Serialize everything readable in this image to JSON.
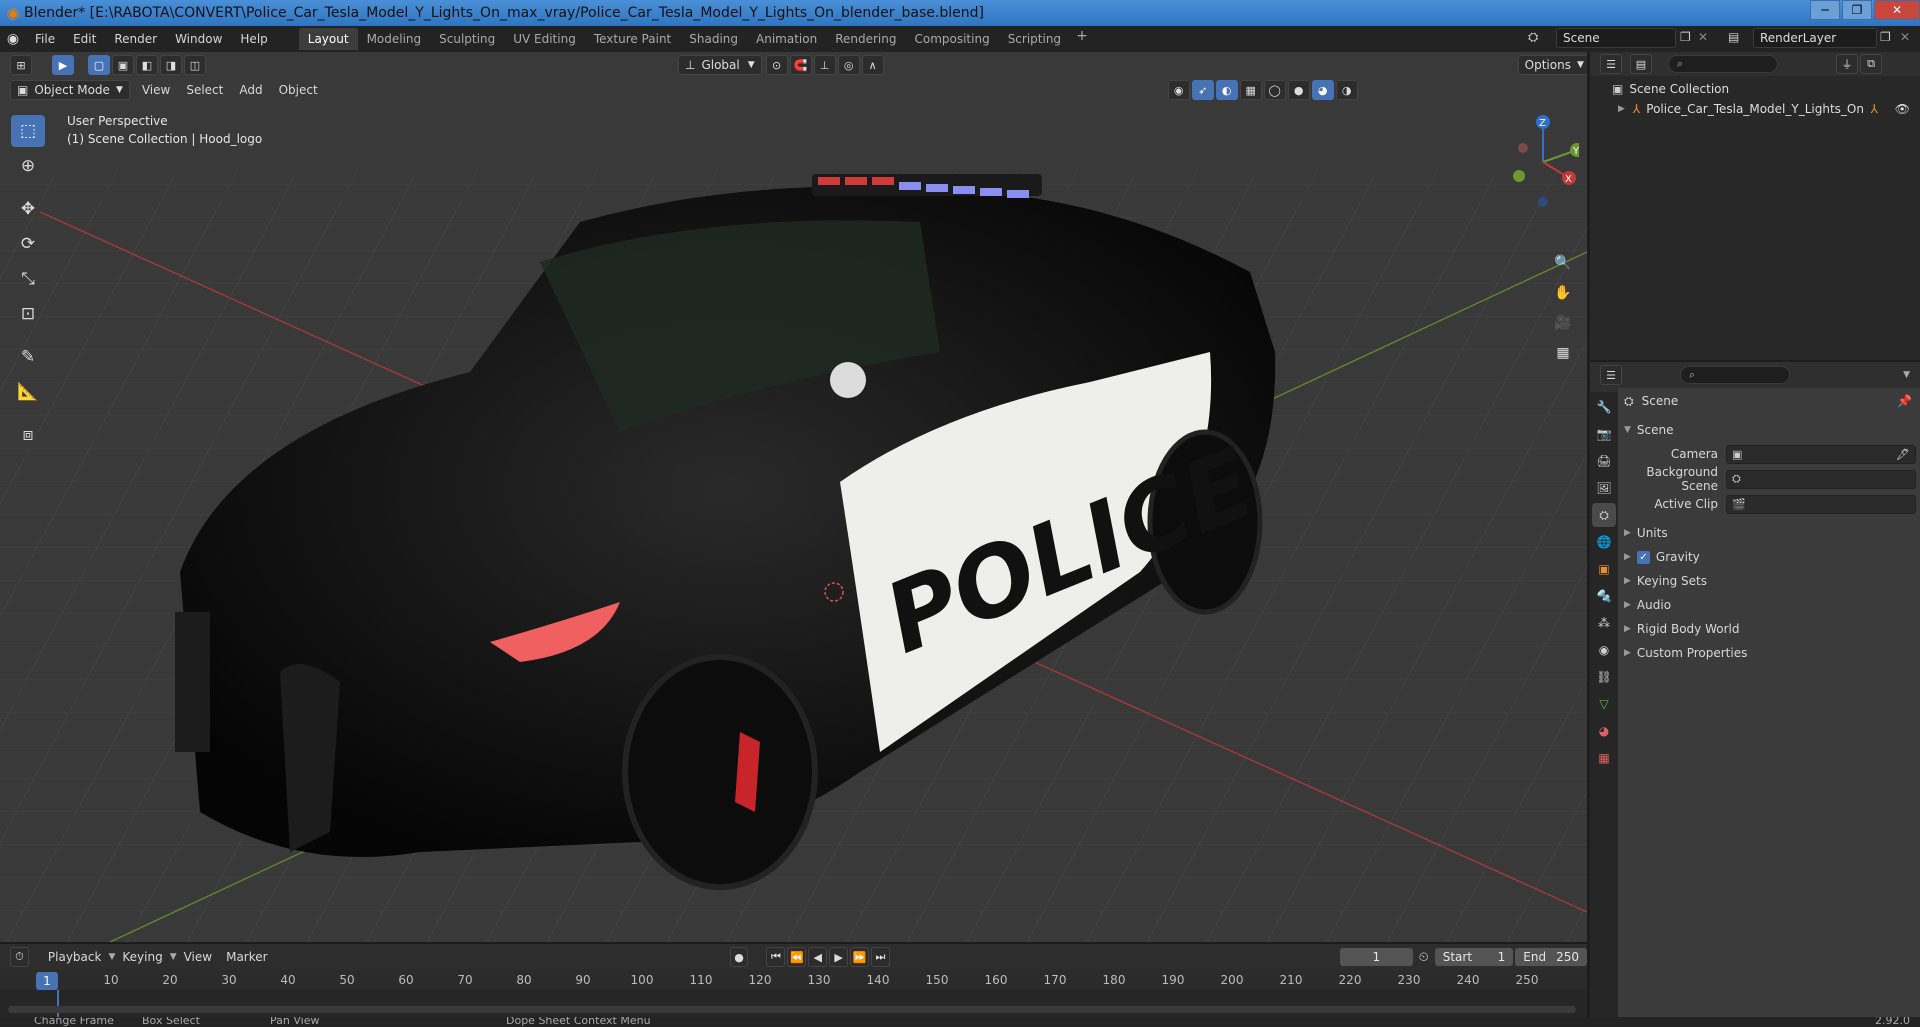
{
  "window": {
    "title": "Blender* [E:\\RABOTA\\CONVERT\\Police_Car_Tesla_Model_Y_Lights_On_max_vray/Police_Car_Tesla_Model_Y_Lights_On_blender_base.blend]",
    "minimize": "─",
    "maximize": "❐",
    "close": "✕"
  },
  "menu": {
    "items": [
      "File",
      "Edit",
      "Render",
      "Window",
      "Help"
    ]
  },
  "workspaces": [
    "Layout",
    "Modeling",
    "Sculpting",
    "UV Editing",
    "Texture Paint",
    "Shading",
    "Animation",
    "Rendering",
    "Compositing",
    "Scripting"
  ],
  "workspace_add": "+",
  "scene_selector": {
    "value": "Scene"
  },
  "render_layer": {
    "value": "RenderLayer"
  },
  "viewport": {
    "mode": "Object Mode",
    "menus": [
      "View",
      "Select",
      "Add",
      "Object"
    ],
    "transform_orientation": "Global",
    "options": "Options",
    "perspective_label": "User Perspective",
    "collection_label": "(1) Scene Collection | Hood_logo",
    "car_text": "POLICE",
    "gizmo": {
      "x": "X",
      "y": "Y",
      "z": "Z"
    }
  },
  "timeline": {
    "menus": [
      "Playback",
      "Keying",
      "View",
      "Marker"
    ],
    "current_frame": "1",
    "start_label": "Start",
    "start_value": "1",
    "end_label": "End",
    "end_value": "250",
    "ticks": [
      "10",
      "20",
      "30",
      "40",
      "50",
      "60",
      "70",
      "80",
      "90",
      "100",
      "110",
      "120",
      "130",
      "140",
      "150",
      "160",
      "170",
      "180",
      "190",
      "200",
      "210",
      "220",
      "230",
      "240",
      "250"
    ],
    "playhead": "1"
  },
  "statusbar": {
    "items": [
      "Change Frame",
      "Box Select",
      "Pan View",
      "Dope Sheet Context Menu"
    ],
    "version": "2.92.0"
  },
  "outliner": {
    "root": "Scene Collection",
    "child": "Police_Car_Tesla_Model_Y_Lights_On"
  },
  "properties": {
    "context": "Scene",
    "section": "Scene",
    "fields": [
      {
        "label": "Camera"
      },
      {
        "label": "Background Scene"
      },
      {
        "label": "Active Clip"
      }
    ],
    "panels": [
      "Units",
      "Gravity",
      "Keying Sets",
      "Audio",
      "Rigid Body World",
      "Custom Properties"
    ]
  },
  "colors": {
    "accent": "#4772b3",
    "viewport_bg": "#393939",
    "axis_x": "#c0393b",
    "axis_y": "#6a9a2f",
    "axis_z": "#2f6fd0"
  }
}
